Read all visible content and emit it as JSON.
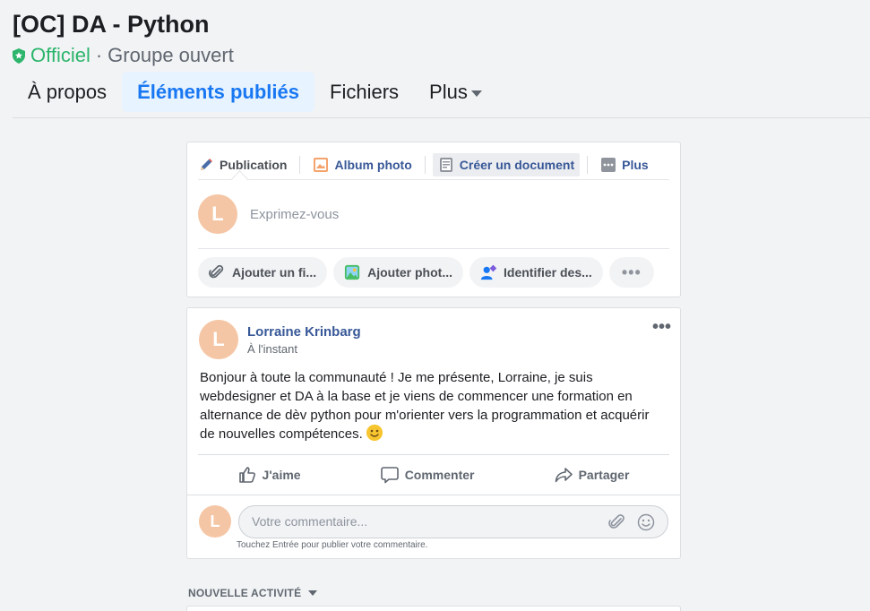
{
  "group": {
    "title": "[OC] DA - Python",
    "official_label": "Officiel",
    "separator": "·",
    "group_type": "Groupe ouvert"
  },
  "tabs": [
    {
      "label": "À propos"
    },
    {
      "label": "Éléments publiés"
    },
    {
      "label": "Fichiers"
    },
    {
      "label": "Plus"
    }
  ],
  "composer": {
    "tabs": [
      {
        "label": "Publication",
        "icon": "pencil-icon"
      },
      {
        "label": "Album photo",
        "icon": "photo-album-icon"
      },
      {
        "label": "Créer un document",
        "icon": "document-icon"
      },
      {
        "label": "Plus",
        "icon": "more-icon"
      }
    ],
    "avatar_letter": "L",
    "placeholder": "Exprimez-vous",
    "actions": [
      {
        "label": "Ajouter un fi...",
        "icon": "paperclip-icon"
      },
      {
        "label": "Ajouter phot...",
        "icon": "photo-icon"
      },
      {
        "label": "Identifier des...",
        "icon": "tag-people-icon"
      },
      {
        "label": "•••",
        "icon": "more-icon"
      }
    ]
  },
  "post": {
    "author": "Lorraine Krinbarg",
    "time": "À l'instant",
    "avatar_letter": "L",
    "menu": "•••",
    "body": "Bonjour à toute la communauté ! Je me présente, Lorraine, je suis webdesigner et DA à la base et je viens de commencer une formation en alternance de dèv python pour m'orienter vers la programmation et acquérir de nouvelles compétences.",
    "actions": [
      {
        "label": "J'aime",
        "icon": "like-icon"
      },
      {
        "label": "Commenter",
        "icon": "comment-icon"
      },
      {
        "label": "Partager",
        "icon": "share-icon"
      }
    ],
    "comment_placeholder": "Votre commentaire...",
    "comment_hint": "Touchez Entrée pour publier votre commentaire."
  },
  "activity": {
    "label": "NOUVELLE ACTIVITÉ"
  },
  "colors": {
    "accent": "#1877f2",
    "official_green": "#2cb56b",
    "link_blue": "#385898",
    "avatar_bg": "#f5c6a5"
  }
}
